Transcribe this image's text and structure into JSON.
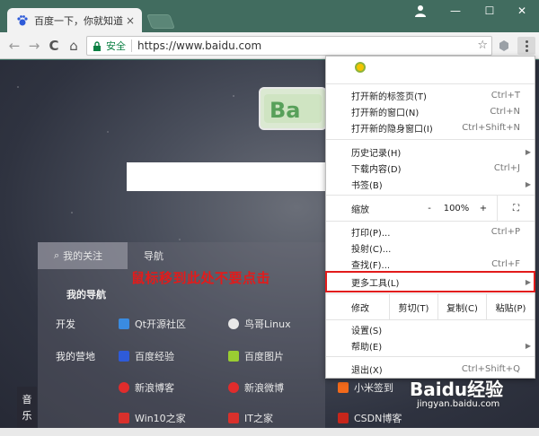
{
  "browser": {
    "tab_title": "百度一下，你就知道",
    "tab_close": "×",
    "window_controls": {
      "minimize": "—",
      "maximize": "☐",
      "close": "✕"
    },
    "nav": {
      "back": "←",
      "forward": "→",
      "reload": "C",
      "home": "⌂"
    },
    "address": {
      "secure_label": "安全",
      "url": "https://www.baidu.com",
      "star": "☆"
    }
  },
  "page": {
    "tabs": [
      {
        "label": "我的关注"
      },
      {
        "label": "导航"
      }
    ],
    "section_title": "我的导航",
    "rows": [
      {
        "label": "开发",
        "links": [
          "Qt开源社区",
          "鸟哥Linux"
        ]
      },
      {
        "label": "我的营地",
        "links": [
          "百度经验",
          "百度图片"
        ]
      },
      {
        "label": "",
        "links": [
          "新浪博客",
          "新浪微博",
          "小米签到"
        ]
      },
      {
        "label": "",
        "links": [
          "Win10之家",
          "IT之家",
          "CSDN博客"
        ]
      }
    ],
    "music_label": [
      "音",
      "乐"
    ],
    "annotation": "鼠标移到此处不要点击"
  },
  "menu": {
    "group1": [
      {
        "label": "打开新的标签页(T)",
        "shortcut": "Ctrl+T"
      },
      {
        "label": "打开新的窗口(N)",
        "shortcut": "Ctrl+N"
      },
      {
        "label": "打开新的隐身窗口(I)",
        "shortcut": "Ctrl+Shift+N"
      }
    ],
    "group2": [
      {
        "label": "历史记录(H)",
        "shortcut": ""
      },
      {
        "label": "下载内容(D)",
        "shortcut": "Ctrl+J"
      },
      {
        "label": "书签(B)",
        "shortcut": ""
      }
    ],
    "zoom": {
      "label": "缩放",
      "minus": "-",
      "value": "100%",
      "plus": "+"
    },
    "group3": [
      {
        "label": "打印(P)...",
        "shortcut": "Ctrl+P"
      },
      {
        "label": "投射(C)...",
        "shortcut": ""
      },
      {
        "label": "查找(F)...",
        "shortcut": "Ctrl+F"
      },
      {
        "label": "更多工具(L)",
        "shortcut": ""
      }
    ],
    "edit": {
      "label": "修改",
      "cut": "剪切(T)",
      "copy": "复制(C)",
      "paste": "粘贴(P)"
    },
    "group4": [
      {
        "label": "设置(S)",
        "shortcut": ""
      },
      {
        "label": "帮助(E)",
        "shortcut": ""
      }
    ],
    "exit": {
      "label": "退出(X)",
      "shortcut": "Ctrl+Shift+Q"
    }
  },
  "watermark": {
    "brand": "Baidu经验",
    "site": "jingyan.baidu.com"
  }
}
